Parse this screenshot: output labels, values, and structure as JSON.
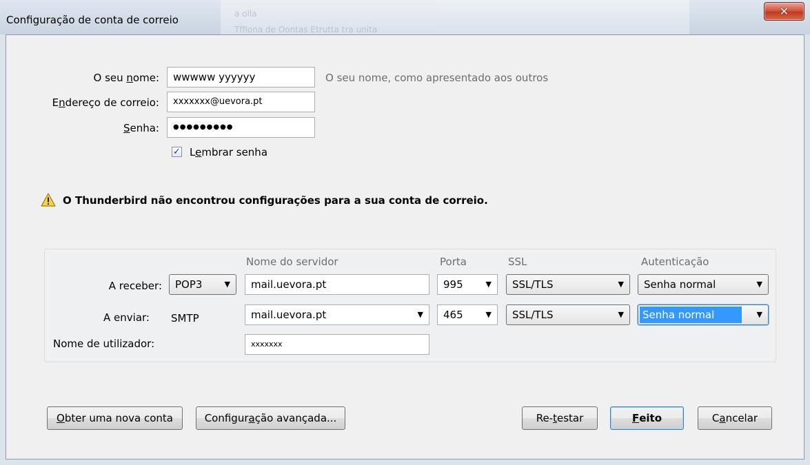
{
  "window": {
    "title": "Configuração de conta de correio",
    "close_symbol": "✕"
  },
  "account": {
    "name_label_pre": "O seu ",
    "name_label_accel": "n",
    "name_label_post": "ome:",
    "name_value": "wwwww yyyyyy",
    "name_hint": "O seu nome, como apresentado aos outros",
    "email_label_pre": "E",
    "email_label_accel": "n",
    "email_label_post": "dereço de correio:",
    "email_value": "xxxxxxx@uevora.pt",
    "password_label_accel": "S",
    "password_label_post": "enha:",
    "password_mask": "●●●●●●●●●",
    "remember_label_pre": "L",
    "remember_label_accel": "e",
    "remember_label_post": "mbrar senha",
    "remember_checked": true,
    "remember_check_glyph": "✓"
  },
  "warning": {
    "text": "O Thunderbird não encontrou configurações para a sua conta de correio."
  },
  "server": {
    "col_server": "Nome do servidor",
    "col_port": "Porta",
    "col_ssl": "SSL",
    "col_auth": "Autenticação",
    "incoming_label": "A receber:",
    "incoming_protocol": "POP3",
    "incoming_host": "mail.uevora.pt",
    "incoming_port": "995",
    "incoming_ssl": "SSL/TLS",
    "incoming_auth": "Senha normal",
    "outgoing_label": "A enviar:",
    "outgoing_protocol": "SMTP",
    "outgoing_host": "mail.uevora.pt",
    "outgoing_port": "465",
    "outgoing_ssl": "SSL/TLS",
    "outgoing_auth": "Senha normal",
    "username_label": "Nome de utilizador:",
    "username_value": "xxxxxxx",
    "dropdown_arrow": "▼"
  },
  "buttons": {
    "new_account_accel": "O",
    "new_account_post": "bter uma nova conta",
    "advanced_pre": "Configur",
    "advanced_accel": "a",
    "advanced_post": "ção avançada...",
    "retest_pre": "Re-",
    "retest_accel": "t",
    "retest_post": "estar",
    "done_accel": "F",
    "done_post": "eito",
    "cancel_pre": "C",
    "cancel_accel": "a",
    "cancel_post": "ncelar"
  },
  "background": {
    "text_1": "a olla",
    "text_2": "Tffiona de Oontas    Etrutta tra unita"
  }
}
